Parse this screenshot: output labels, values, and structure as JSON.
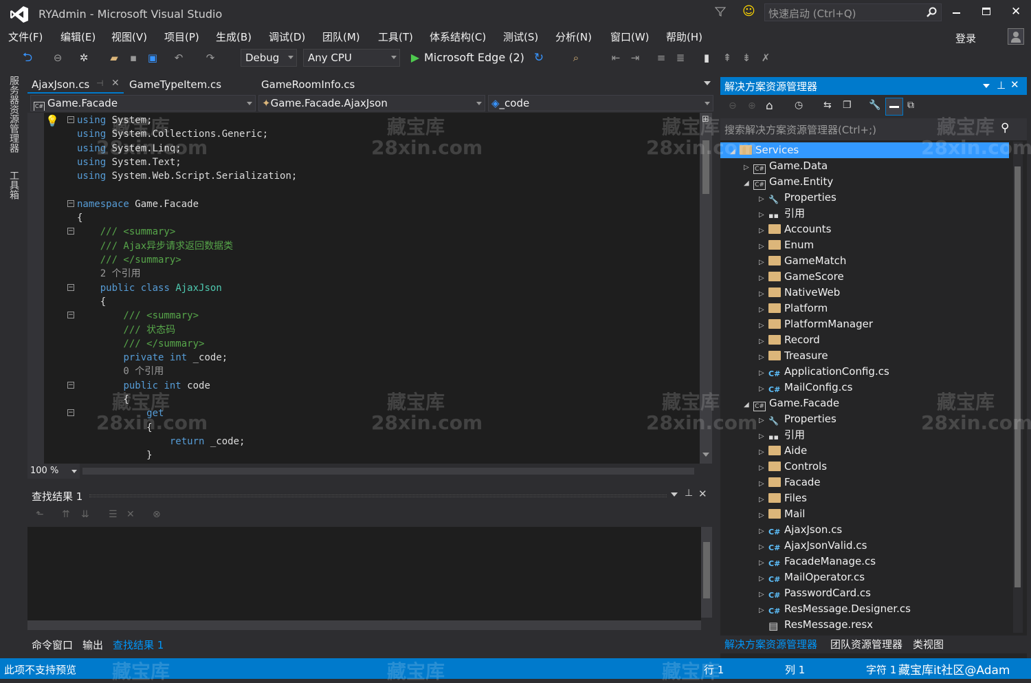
{
  "window": {
    "title": "RYAdmin - Microsoft Visual Studio",
    "quick_launch_placeholder": "快速启动 (Ctrl+Q)",
    "login": "登录"
  },
  "menu": [
    "文件(F)",
    "编辑(E)",
    "视图(V)",
    "项目(P)",
    "生成(B)",
    "调试(D)",
    "团队(M)",
    "工具(T)",
    "体系结构(C)",
    "测试(S)",
    "分析(N)",
    "窗口(W)",
    "帮助(H)"
  ],
  "toolbar": {
    "config": "Debug",
    "platform": "Any CPU",
    "run_target": "Microsoft Edge (2)"
  },
  "left_tabs": [
    "服务器资源管理器",
    "工具箱"
  ],
  "doc_tabs": [
    "AjaxJson.cs",
    "GameTypeItem.cs",
    "GameRoomInfo.cs"
  ],
  "navbar": {
    "project": "Game.Facade",
    "type": "Game.Facade.AjaxJson",
    "member": "_code"
  },
  "code": [
    {
      "t": "using System;",
      "k": "using"
    },
    {
      "t": "using System.Collections.Generic;",
      "k": "using"
    },
    {
      "t": "using System.Linq;",
      "k": "using"
    },
    {
      "t": "using System.Text;",
      "k": "using"
    },
    {
      "t": "using System.Web.Script.Serialization;",
      "k": "using"
    },
    {
      "t": "",
      "k": ""
    },
    {
      "t": "namespace Game.Facade",
      "k": "namespace"
    },
    {
      "t": "{",
      "k": ""
    },
    {
      "t": "    /// <summary>",
      "k": "cm"
    },
    {
      "t": "    /// Ajax异步请求返回数据类",
      "k": "cm"
    },
    {
      "t": "    /// </summary>",
      "k": "cm"
    },
    {
      "t": "    2 个引用",
      "k": "cl"
    },
    {
      "t": "    public class AjaxJson",
      "k": "class"
    },
    {
      "t": "    {",
      "k": ""
    },
    {
      "t": "        /// <summary>",
      "k": "cm"
    },
    {
      "t": "        /// 状态码",
      "k": "cm"
    },
    {
      "t": "        /// </summary>",
      "k": "cm"
    },
    {
      "t": "        private int _code;",
      "k": "field"
    },
    {
      "t": "        0 个引用",
      "k": "cl"
    },
    {
      "t": "        public int code",
      "k": "prop"
    },
    {
      "t": "        {",
      "k": ""
    },
    {
      "t": "            get",
      "k": "get"
    },
    {
      "t": "            {",
      "k": ""
    },
    {
      "t": "                return _code;",
      "k": "ret"
    },
    {
      "t": "            }",
      "k": ""
    }
  ],
  "zoom": "100 %",
  "find_panel": {
    "title": "查找结果 1"
  },
  "bottom_tabs": [
    "命令窗口",
    "输出",
    "查找结果 1"
  ],
  "solution_explorer": {
    "title": "解决方案资源管理器",
    "search_placeholder": "搜索解决方案资源管理器(Ctrl+;)",
    "nodes": [
      {
        "label": "Services",
        "level": 0,
        "icon": "folder",
        "exp": "open",
        "sel": true
      },
      {
        "label": "Game.Data",
        "level": 1,
        "icon": "project",
        "exp": "closed"
      },
      {
        "label": "Game.Entity",
        "level": 1,
        "icon": "project",
        "exp": "open"
      },
      {
        "label": "Properties",
        "level": 2,
        "icon": "wrench",
        "exp": "closed"
      },
      {
        "label": "引用",
        "level": 2,
        "icon": "refs",
        "exp": "closed"
      },
      {
        "label": "Accounts",
        "level": 2,
        "icon": "folder",
        "exp": "closed"
      },
      {
        "label": "Enum",
        "level": 2,
        "icon": "folder",
        "exp": "closed"
      },
      {
        "label": "GameMatch",
        "level": 2,
        "icon": "folder",
        "exp": "closed"
      },
      {
        "label": "GameScore",
        "level": 2,
        "icon": "folder",
        "exp": "closed"
      },
      {
        "label": "NativeWeb",
        "level": 2,
        "icon": "folder",
        "exp": "closed"
      },
      {
        "label": "Platform",
        "level": 2,
        "icon": "folder",
        "exp": "closed"
      },
      {
        "label": "PlatformManager",
        "level": 2,
        "icon": "folder",
        "exp": "closed"
      },
      {
        "label": "Record",
        "level": 2,
        "icon": "folder",
        "exp": "closed"
      },
      {
        "label": "Treasure",
        "level": 2,
        "icon": "folder",
        "exp": "closed"
      },
      {
        "label": "ApplicationConfig.cs",
        "level": 2,
        "icon": "cs",
        "exp": "closed"
      },
      {
        "label": "MailConfig.cs",
        "level": 2,
        "icon": "cs",
        "exp": "closed"
      },
      {
        "label": "Game.Facade",
        "level": 1,
        "icon": "project",
        "exp": "open"
      },
      {
        "label": "Properties",
        "level": 2,
        "icon": "wrench",
        "exp": "closed"
      },
      {
        "label": "引用",
        "level": 2,
        "icon": "refs",
        "exp": "closed"
      },
      {
        "label": "Aide",
        "level": 2,
        "icon": "folder",
        "exp": "closed"
      },
      {
        "label": "Controls",
        "level": 2,
        "icon": "folder",
        "exp": "closed"
      },
      {
        "label": "Facade",
        "level": 2,
        "icon": "folder",
        "exp": "closed"
      },
      {
        "label": "Files",
        "level": 2,
        "icon": "folder",
        "exp": "closed"
      },
      {
        "label": "Mail",
        "level": 2,
        "icon": "folder",
        "exp": "closed"
      },
      {
        "label": "AjaxJson.cs",
        "level": 2,
        "icon": "cs",
        "exp": "closed"
      },
      {
        "label": "AjaxJsonValid.cs",
        "level": 2,
        "icon": "cs",
        "exp": "closed"
      },
      {
        "label": "FacadeManage.cs",
        "level": 2,
        "icon": "cs",
        "exp": "closed"
      },
      {
        "label": "MailOperator.cs",
        "level": 2,
        "icon": "cs",
        "exp": "closed"
      },
      {
        "label": "PasswordCard.cs",
        "level": 2,
        "icon": "cs",
        "exp": "closed"
      },
      {
        "label": "ResMessage.Designer.cs",
        "level": 2,
        "icon": "cs",
        "exp": "closed"
      },
      {
        "label": "ResMessage.resx",
        "level": 2,
        "icon": "file",
        "exp": "none"
      }
    ],
    "tabs": [
      "解决方案资源管理器",
      "团队资源管理器",
      "类视图"
    ]
  },
  "status": {
    "left": "此项不支持预览",
    "line": "行 1",
    "col": "列 1",
    "char": "字符 1"
  },
  "watermark": {
    "line1": "藏宝库",
    "line2": "28xin.com",
    "corner": "藏宝库it社区@Adam"
  },
  "colors": {
    "accent": "#007acc",
    "selection": "#3399ff",
    "background": "#2d2d30",
    "editor": "#1e1e1e"
  }
}
